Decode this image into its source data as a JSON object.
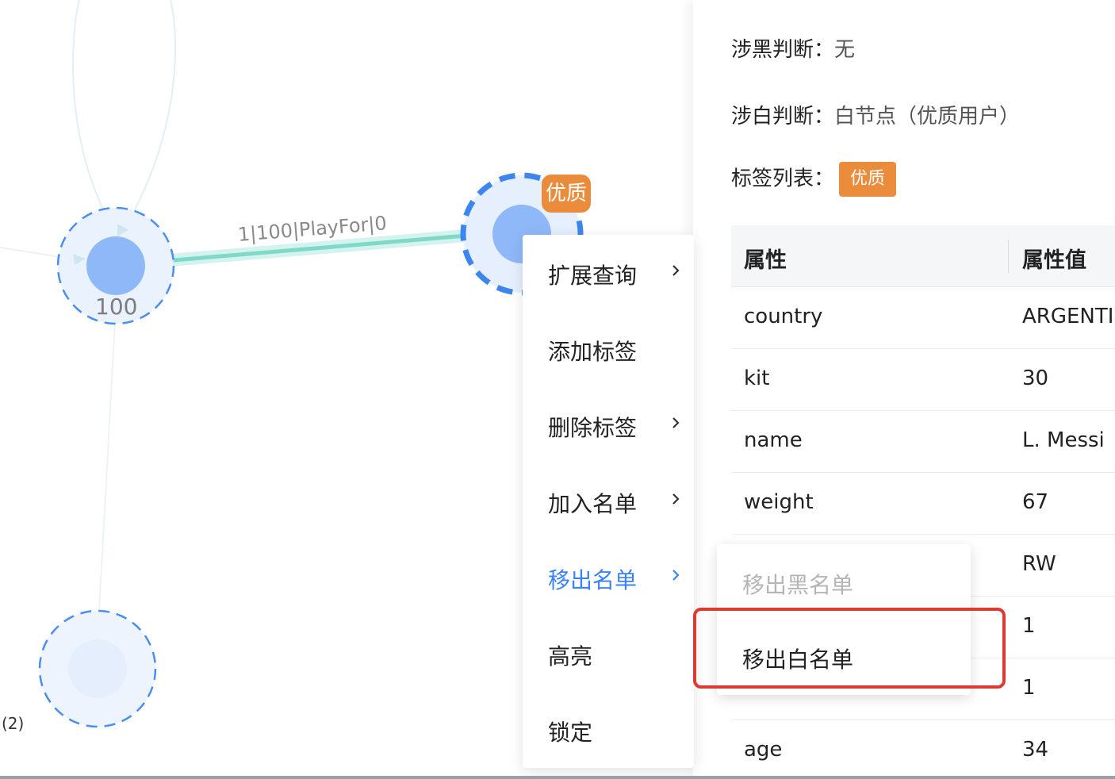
{
  "graph": {
    "edge_label": "1|100|PlayFor|0",
    "node_left_label": "100",
    "node_right_badge": "优质",
    "count_label": "(2)",
    "colors": {
      "node": "#8fb8f8",
      "edge": "#7fd9c8",
      "badge": "#ea8c3c"
    }
  },
  "panel": {
    "black_label": "涉黑判断：",
    "black_value": "无",
    "white_label": "涉白判断：",
    "white_value": "白节点（优质用户）",
    "tags_label": "标签列表：",
    "tag": "优质",
    "table": {
      "headers": [
        "属性",
        "属性值"
      ],
      "rows": [
        [
          "country",
          "ARGENTI"
        ],
        [
          "kit",
          "30"
        ],
        [
          "name",
          "L. Messi"
        ],
        [
          "weight",
          "67"
        ],
        [
          "",
          "RW"
        ],
        [
          "",
          "1"
        ],
        [
          "",
          "1"
        ],
        [
          "age",
          "34"
        ]
      ]
    }
  },
  "context_menu": {
    "items": [
      {
        "label": "扩展查询",
        "has_sub": true
      },
      {
        "label": "添加标签",
        "has_sub": false
      },
      {
        "label": "删除标签",
        "has_sub": true
      },
      {
        "label": "加入名单",
        "has_sub": true
      },
      {
        "label": "移出名单",
        "has_sub": true,
        "active": true
      },
      {
        "label": "高亮",
        "has_sub": false
      },
      {
        "label": "锁定",
        "has_sub": false
      }
    ],
    "active_color": "#3b82f6"
  },
  "submenu": {
    "items": [
      {
        "label": "移出黑名单",
        "disabled": true
      },
      {
        "label": "移出白名单",
        "disabled": false
      }
    ],
    "highlight_color": "#dd3b32"
  }
}
